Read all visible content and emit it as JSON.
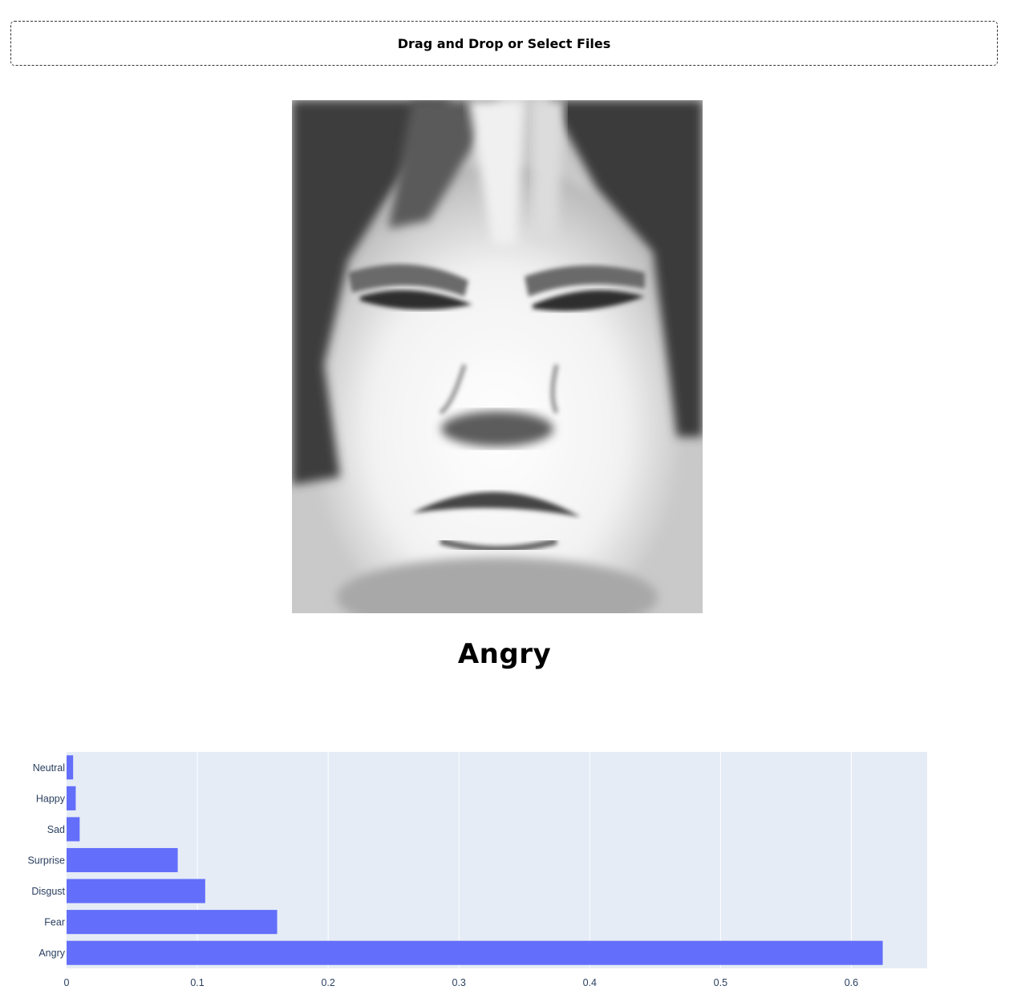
{
  "upload": {
    "label": "Drag and Drop or Select Files"
  },
  "prediction": {
    "label": "Angry"
  },
  "image": {
    "description_icon": "grayscale-face-photo"
  },
  "colors": {
    "bar": "#636efa",
    "plot_bg": "#e5ecf6",
    "axis_text": "#2a3f5f"
  },
  "chart_data": {
    "type": "bar",
    "orientation": "horizontal",
    "categories": [
      "Angry",
      "Fear",
      "Disgust",
      "Surprise",
      "Sad",
      "Happy",
      "Neutral"
    ],
    "values": [
      0.624,
      0.161,
      0.106,
      0.085,
      0.01,
      0.007,
      0.005
    ],
    "xlim": [
      0,
      0.658
    ],
    "xticks": [
      0,
      0.1,
      0.2,
      0.3,
      0.4,
      0.5,
      0.6
    ],
    "xtick_labels": [
      "0",
      "0.1",
      "0.2",
      "0.3",
      "0.4",
      "0.5",
      "0.6"
    ],
    "title": "",
    "xlabel": "",
    "ylabel": "",
    "grid": true,
    "legend": false
  }
}
